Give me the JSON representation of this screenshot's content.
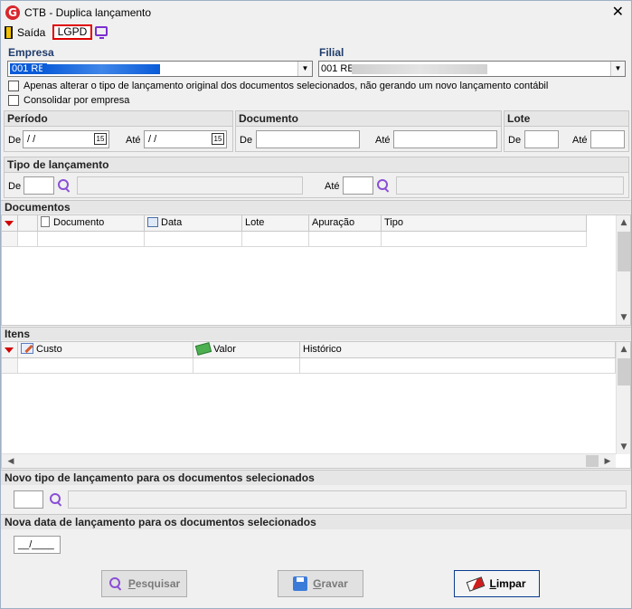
{
  "window": {
    "title": "CTB - Duplica lançamento",
    "close_glyph": "✕"
  },
  "toolbar": {
    "exit_label": "Saída",
    "lgpd_label": "LGPD"
  },
  "company": {
    "empresa_label": "Empresa",
    "empresa_value": "001 RE",
    "filial_label": "Filial",
    "filial_value": "001 RE"
  },
  "options": {
    "only_change_type": "Apenas alterar o tipo de lançamento original dos documentos selecionados, não gerando um novo lançamento contábil",
    "consolidate": "Consolidar por empresa"
  },
  "periodo": {
    "title": "Período",
    "de_label": "De",
    "de_value": " /  /",
    "ate_label": "Até",
    "ate_value": " /  /"
  },
  "documento": {
    "title": "Documento",
    "de_label": "De",
    "ate_label": "Até"
  },
  "lote": {
    "title": "Lote",
    "de_label": "De",
    "ate_label": "Até"
  },
  "tipo_lancamento": {
    "title": "Tipo de lançamento",
    "de_label": "De",
    "ate_label": "Até"
  },
  "documentos_grid": {
    "title": "Documentos",
    "columns": [
      "Documento",
      "Data",
      "Lote",
      "Apuração",
      "Tipo"
    ]
  },
  "itens_grid": {
    "title": "Itens",
    "columns": [
      "Custo",
      "Valor",
      "Histórico"
    ]
  },
  "novo_tipo": {
    "title": "Novo tipo de lançamento para os documentos selecionados"
  },
  "nova_data": {
    "title": "Nova data de lançamento para os documentos selecionados",
    "value": "__/____"
  },
  "buttons": {
    "pesquisar_first": "P",
    "pesquisar_rest": "esquisar",
    "gravar_first": "G",
    "gravar_rest": "ravar",
    "limpar_first": "L",
    "limpar_rest": "impar"
  },
  "calendar_glyph": "15",
  "scroll": {
    "up": "▲",
    "down": "▼",
    "left": "◀",
    "right": "▶"
  },
  "colors": {
    "selection": "#0a5bd8",
    "accent_red": "#e00000",
    "icon_purple": "#8a4fd6"
  }
}
